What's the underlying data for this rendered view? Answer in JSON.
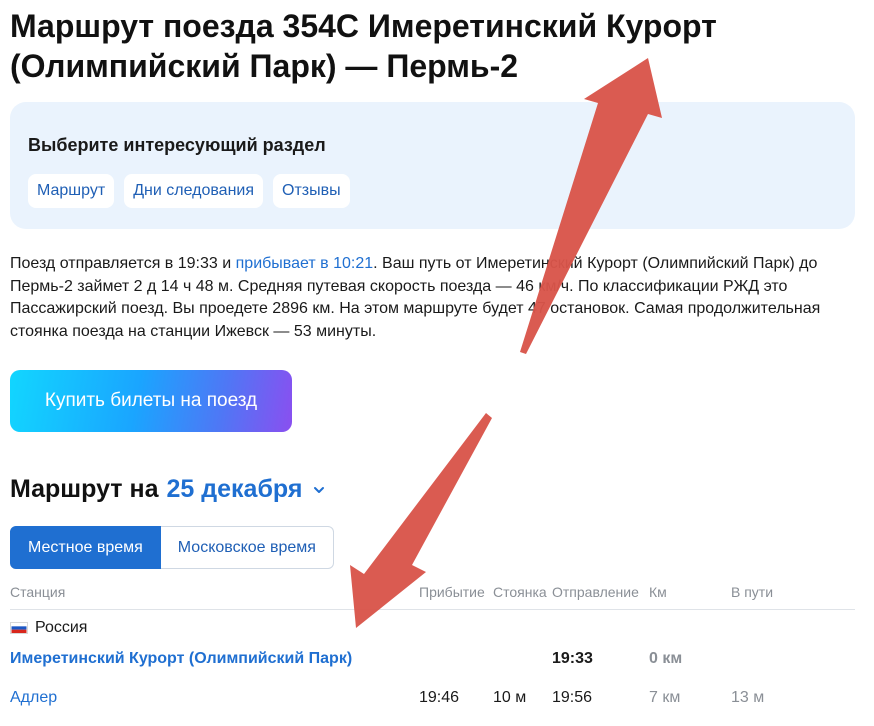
{
  "page": {
    "title": "Маршрут поезда 354С Имеретинский Курорт (Олимпийский Парк) — Пермь-2"
  },
  "sections": {
    "heading": "Выберите интересующий раздел",
    "chips": [
      "Маршрут",
      "Дни следования",
      "Отзывы"
    ]
  },
  "description": {
    "part1": "Поезд отправляется в 19:33 и ",
    "link": "прибывает в 10:21",
    "part2": ". Ваш путь от Имеретинский Курорт (Олимпийский Парк) до Пермь-2 займет 2 д 14 ч 48 м. Средняя путевая скорость поезда — 46 км/ч. По классификации РЖД это Пассажирский поезд. Вы проедете 2896 км. На этом маршруте будет 47 остановок. Самая продолжительная стоянка поезда на станции Ижевск — 53 минуты."
  },
  "buy_button": "Купить билеты на поезд",
  "route": {
    "heading": "Маршрут на",
    "date": "25 декабря"
  },
  "timezone": {
    "local": "Местное время",
    "moscow": "Московское время"
  },
  "table": {
    "headers": {
      "station": "Станция",
      "arrival": "Прибытие",
      "stop": "Стоянка",
      "departure": "Отправление",
      "km": "Км",
      "travel": "В пути"
    },
    "country": "Россия",
    "rows": [
      {
        "station": "Имеретинский Курорт (Олимпийский Парк)",
        "arrival": "",
        "stop": "",
        "departure": "19:33",
        "km": "0 км",
        "travel": ""
      },
      {
        "station": "Адлер",
        "arrival": "19:46",
        "stop": "10 м",
        "departure": "19:56",
        "km": "7 км",
        "travel": "13 м"
      }
    ]
  },
  "colors": {
    "accent": "#1f6fd1",
    "annotation_arrow": "#d9544a"
  }
}
